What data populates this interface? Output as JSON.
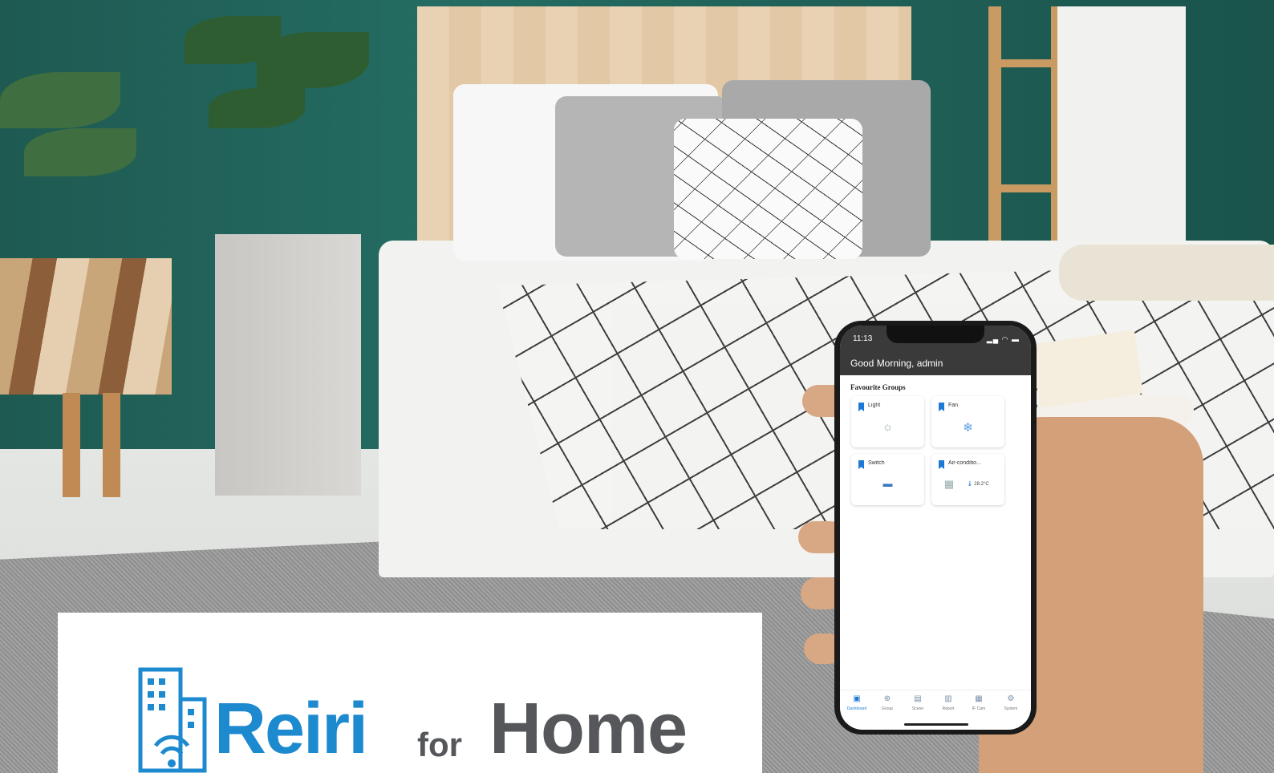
{
  "logo": {
    "brand": "Reiri",
    "for": "for",
    "home": "Home",
    "brand_color": "#1d89cf",
    "text_color": "#55575a"
  },
  "phone": {
    "status_time": "11:13",
    "greeting": "Good Morning, admin",
    "section_title": "Favourite Groups",
    "groups": [
      {
        "label": "Light",
        "icon": "lightbulb-icon"
      },
      {
        "label": "Fan",
        "icon": "fan-icon"
      },
      {
        "label": "Switch",
        "icon": "switch-icon"
      },
      {
        "label": "Air-conditio...",
        "icon": "air-conditioner-icon",
        "temperature": "28.2°C"
      }
    ],
    "tabs": [
      {
        "label": "Dashboard",
        "icon": "dashboard-icon",
        "active": true
      },
      {
        "label": "Group",
        "icon": "group-icon"
      },
      {
        "label": "Scene",
        "icon": "scene-icon"
      },
      {
        "label": "Report",
        "icon": "report-icon"
      },
      {
        "label": "IF Cam",
        "icon": "camera-icon"
      },
      {
        "label": "System",
        "icon": "gear-icon"
      }
    ],
    "accent_color": "#1e78d6"
  }
}
